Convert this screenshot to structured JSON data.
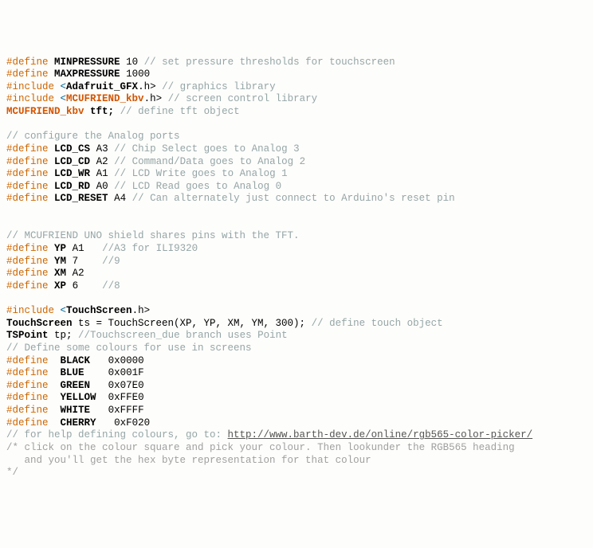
{
  "code": {
    "l01": {
      "kw": "#define",
      "name": "MINPRESSURE",
      "val": "10",
      "comment": "// set pressure thresholds for touchscreen"
    },
    "l02": {
      "kw": "#define",
      "name": "MAXPRESSURE",
      "val": "1000"
    },
    "l03": {
      "kw": "#include",
      "lt": "<",
      "hdr": "Adafruit_GFX",
      "ext": ".h>",
      "comment": "// graphics library"
    },
    "l04": {
      "kw": "#include",
      "lt": "<",
      "hdr": "MCUFRIEND_kbv",
      "ext": ".h>",
      "comment": "// screen control library"
    },
    "l05": {
      "type": "MCUFRIEND_kbv",
      "var": "tft;",
      "comment": "// define tft object"
    },
    "l07": {
      "comment": "// configure the Analog ports"
    },
    "l08": {
      "kw": "#define",
      "name": "LCD_CS",
      "val": "A3",
      "comment": "// Chip Select goes to Analog 3"
    },
    "l09": {
      "kw": "#define",
      "name": "LCD_CD",
      "val": "A2",
      "comment": "// Command/Data goes to Analog 2"
    },
    "l10": {
      "kw": "#define",
      "name": "LCD_WR",
      "val": "A1",
      "comment": "// LCD Write goes to Analog 1"
    },
    "l11": {
      "kw": "#define",
      "name": "LCD_RD",
      "val": "A0",
      "comment": "// LCD Read goes to Analog 0"
    },
    "l12": {
      "kw": "#define",
      "name": "LCD_RESET",
      "val": "A4",
      "comment": "// Can alternately just connect to Arduino's reset pin"
    },
    "l15": {
      "comment": "// MCUFRIEND UNO shield shares pins with the TFT."
    },
    "l16": {
      "kw": "#define",
      "name": "YP",
      "val": "A1",
      "comment": "//A3 for ILI9320"
    },
    "l17": {
      "kw": "#define",
      "name": "YM",
      "val": "7",
      "comment": "//9"
    },
    "l18": {
      "kw": "#define",
      "name": "XM",
      "val": "A2"
    },
    "l19": {
      "kw": "#define",
      "name": "XP",
      "val": "6",
      "comment": "//8"
    },
    "l21": {
      "kw": "#include",
      "lt": "<",
      "hdr": "TouchScreen",
      "ext": ".h>"
    },
    "l22": {
      "type": "TouchScreen",
      "rest": " ts = TouchScreen(XP, YP, XM, YM, 300);",
      "comment": "// define touch object"
    },
    "l23": {
      "type": "TSPoint",
      "rest": " tp;",
      "comment": "//Touchscreen_due branch uses Point"
    },
    "l24": {
      "comment": "// Define some colours for use in screens"
    },
    "l25": {
      "kw": "#define",
      "name": "BLACK",
      "val": "0x0000"
    },
    "l26": {
      "kw": "#define",
      "name": "BLUE",
      "val": "0x001F"
    },
    "l27": {
      "kw": "#define",
      "name": "GREEN",
      "val": "0x07E0"
    },
    "l28": {
      "kw": "#define",
      "name": "YELLOW",
      "val": "0xFFE0"
    },
    "l29": {
      "kw": "#define",
      "name": "WHITE",
      "val": "0xFFFF"
    },
    "l30": {
      "kw": "#define",
      "name": "CHERRY",
      "val": "0xF020"
    },
    "l31": {
      "pre": "// for help defining colours, go to: ",
      "link": "http://www.barth-dev.de/online/rgb565-color-picker/"
    },
    "l32": {
      "ml": "/* click on the colour square and pick your colour. Then lookunder the RGB565 heading"
    },
    "l33": {
      "ml": "   and you'll get the hex byte representation for that colour"
    },
    "l34": {
      "ml": "*/"
    }
  }
}
